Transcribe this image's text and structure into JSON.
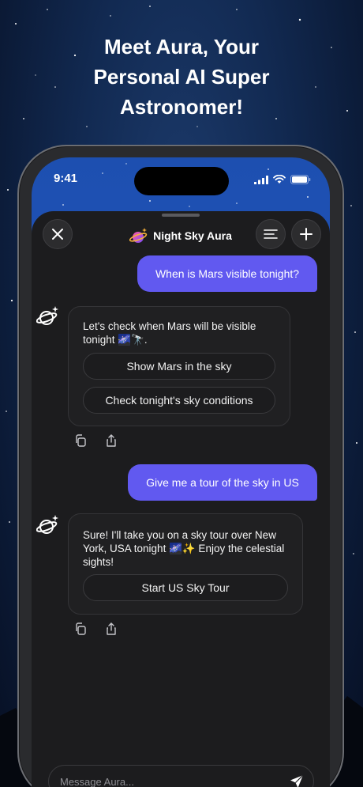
{
  "headline": {
    "line1": "Meet Aura, Your",
    "line2": "Personal AI Super",
    "line3": "Astronomer!"
  },
  "status_bar": {
    "time": "9:41"
  },
  "chat_header": {
    "title": "Night Sky Aura",
    "close_icon": "close-icon",
    "history_icon": "menu-lines-icon",
    "new_chat_icon": "plus-icon"
  },
  "messages": [
    {
      "role": "user",
      "text": "When is Mars visible tonight?"
    },
    {
      "role": "assistant",
      "text": "Let's check when Mars will be visible tonight 🌌🔭.",
      "chips": [
        "Show Mars in the sky",
        "Check tonight's sky conditions"
      ]
    },
    {
      "role": "user",
      "text": "Give me a tour of the sky in US"
    },
    {
      "role": "assistant",
      "text": "Sure! I'll take you on a sky tour over New York, USA tonight 🌌✨ Enjoy the celestial sights!",
      "chips": [
        "Start US Sky Tour"
      ]
    }
  ],
  "composer": {
    "placeholder": "Message Aura..."
  },
  "colors": {
    "accent": "#6159f0",
    "sheet_bg": "#1c1c1e",
    "card_bg": "#202022"
  }
}
